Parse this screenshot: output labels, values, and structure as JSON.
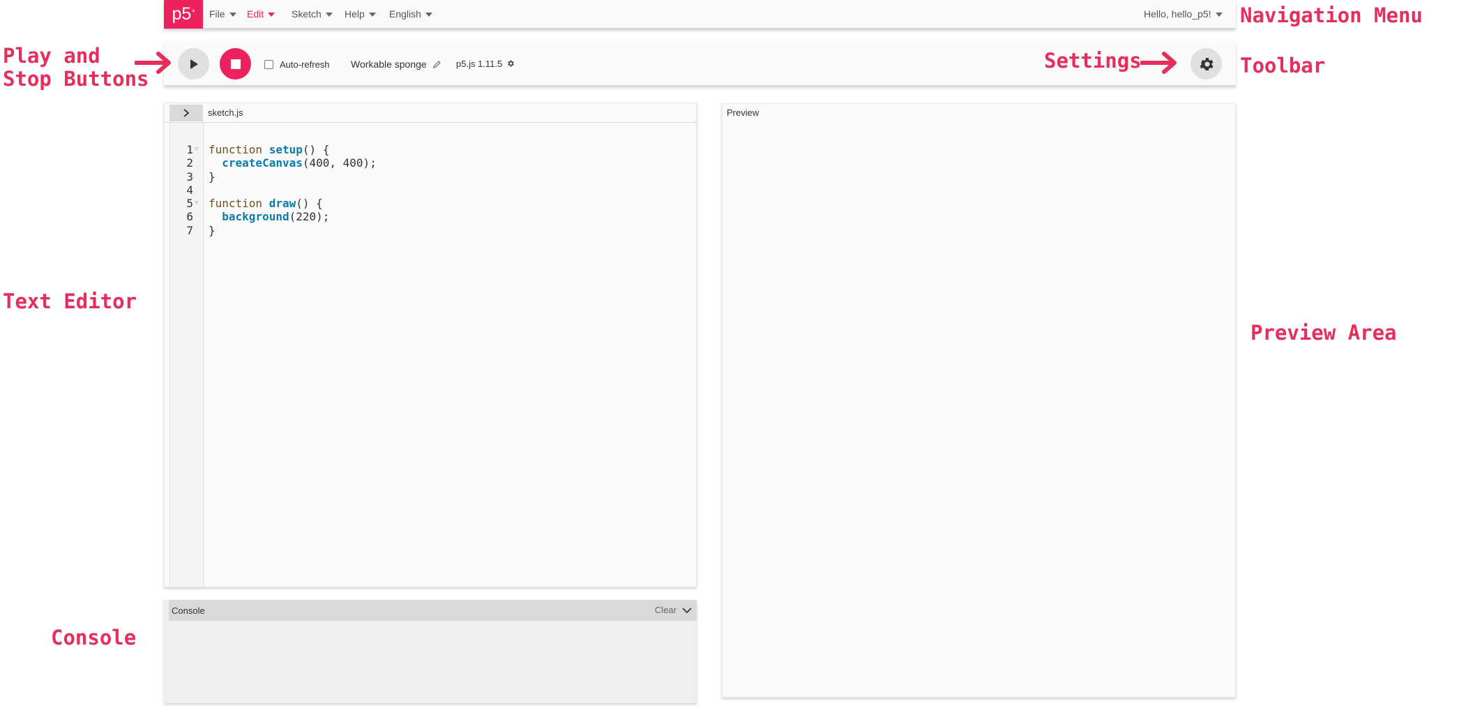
{
  "nav": {
    "logo": "p5",
    "logo_sup": "*",
    "menus": [
      {
        "label": "File"
      },
      {
        "label": "Edit"
      },
      {
        "label": "Sketch"
      },
      {
        "label": "Help"
      },
      {
        "label": "English"
      }
    ],
    "active_menu": "Edit",
    "user_greeting": "Hello, hello_p5!"
  },
  "toolbar": {
    "play_label": "Play",
    "stop_label": "Stop",
    "auto_refresh_label": "Auto-refresh",
    "auto_refresh_checked": false,
    "sketch_name": "Workable sponge",
    "p5_version": "p5.js 1.11.5"
  },
  "editor": {
    "file_tab": "sketch.js",
    "lines": [
      {
        "no": "1",
        "fold": true
      },
      {
        "no": "2",
        "fold": false
      },
      {
        "no": "3",
        "fold": false
      },
      {
        "no": "4",
        "fold": false
      },
      {
        "no": "5",
        "fold": true
      },
      {
        "no": "6",
        "fold": false
      },
      {
        "no": "7",
        "fold": false
      }
    ],
    "code": [
      [
        {
          "t": "function ",
          "c": "kw"
        },
        {
          "t": "setup",
          "c": "fn"
        },
        {
          "t": "() {",
          "c": ""
        }
      ],
      [
        {
          "t": "  ",
          "c": ""
        },
        {
          "t": "createCanvas",
          "c": "fn"
        },
        {
          "t": "(400, 400);",
          "c": ""
        }
      ],
      [
        {
          "t": "}",
          "c": ""
        }
      ],
      [],
      [
        {
          "t": "function ",
          "c": "kw"
        },
        {
          "t": "draw",
          "c": "fn"
        },
        {
          "t": "() {",
          "c": ""
        }
      ],
      [
        {
          "t": "  ",
          "c": ""
        },
        {
          "t": "background",
          "c": "fn"
        },
        {
          "t": "(220);",
          "c": ""
        }
      ],
      [
        {
          "t": "}",
          "c": ""
        }
      ]
    ]
  },
  "console": {
    "title": "Console",
    "clear_label": "Clear"
  },
  "preview": {
    "label": "Preview"
  },
  "annotations": {
    "navigation_menu": "Navigation Menu",
    "toolbar": "Toolbar",
    "play_stop_line1": "Play and",
    "play_stop_line2": "Stop Buttons",
    "settings": "Settings",
    "text_editor": "Text Editor",
    "preview_area": "Preview Area",
    "console": "Console"
  },
  "colors": {
    "accent": "#ed225d",
    "annotation": "#e62e5c",
    "keyword": "#704f21",
    "function": "#0b7ca9"
  }
}
